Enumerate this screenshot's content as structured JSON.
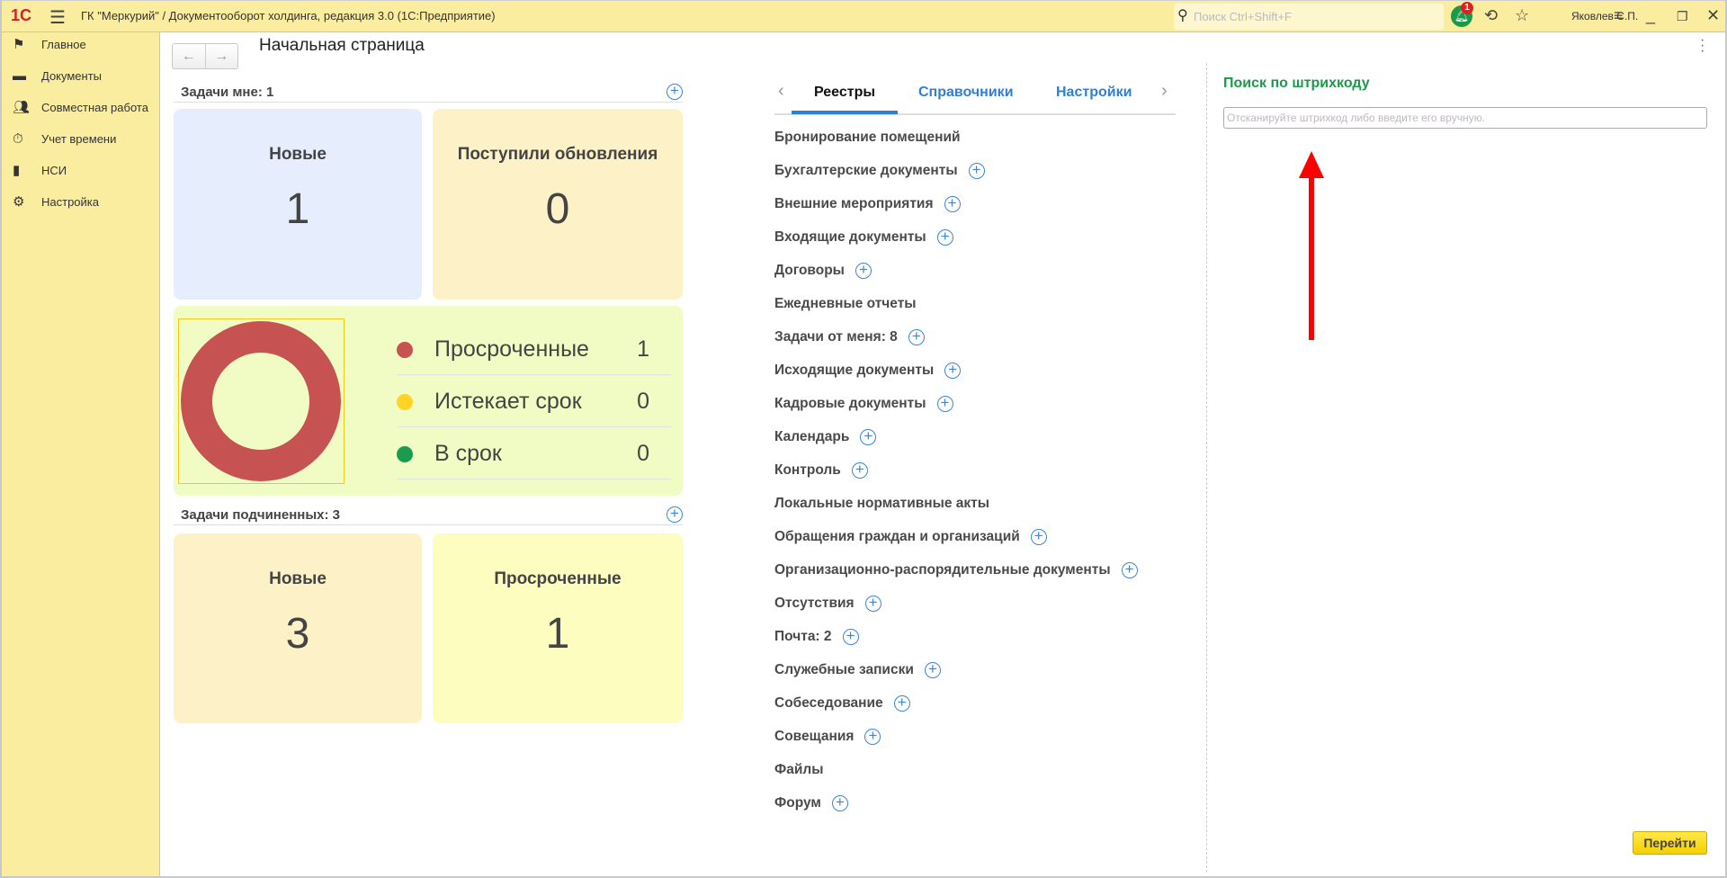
{
  "window": {
    "title": "ГК \"Меркурий\" / Документооборот холдинга, редакция 3.0  (1С:Предприятие)",
    "search_placeholder": "Поиск Ctrl+Shift+F",
    "notifications": "1",
    "user": "Яковлев С.П.",
    "logo": "1С"
  },
  "sidebar": {
    "items": [
      {
        "label": "Главное",
        "icon": "flag-icon"
      },
      {
        "label": "Документы",
        "icon": "folder-icon"
      },
      {
        "label": "Совместная работа",
        "icon": "users-icon"
      },
      {
        "label": "Учет времени",
        "icon": "stopwatch-icon"
      },
      {
        "label": "НСИ",
        "icon": "books-icon"
      },
      {
        "label": "Настройка",
        "icon": "gear-icon"
      }
    ]
  },
  "page": {
    "title": "Начальная страница"
  },
  "my_tasks": {
    "title": "Задачи мне: 1",
    "cards": [
      {
        "label": "Новые",
        "value": "1"
      },
      {
        "label": "Поступили обновления",
        "value": "0"
      }
    ]
  },
  "chart_data": {
    "type": "pie",
    "donut": true,
    "categories": [
      "Просроченные",
      "Истекает срок",
      "В срок"
    ],
    "values": [
      1,
      0,
      0
    ],
    "colors": [
      "#c75252",
      "#ffd426",
      "#1a9b50"
    ]
  },
  "legend": [
    {
      "label": "Просроченные",
      "value": "1"
    },
    {
      "label": "Истекает срок",
      "value": "0"
    },
    {
      "label": "В срок",
      "value": "0"
    }
  ],
  "sub_tasks": {
    "title": "Задачи подчиненных: 3",
    "cards": [
      {
        "label": "Новые",
        "value": "3"
      },
      {
        "label": "Просроченные",
        "value": "1"
      }
    ]
  },
  "tabs": [
    {
      "label": "Реестры",
      "active": true
    },
    {
      "label": "Справочники"
    },
    {
      "label": "Настройки"
    }
  ],
  "registers": [
    {
      "label": "Бронирование помещений",
      "plus": false
    },
    {
      "label": "Бухгалтерские документы",
      "plus": true
    },
    {
      "label": "Внешние мероприятия",
      "plus": true
    },
    {
      "label": "Входящие документы",
      "plus": true
    },
    {
      "label": "Договоры",
      "plus": true
    },
    {
      "label": "Ежедневные отчеты",
      "plus": false
    },
    {
      "label": "Задачи от меня: 8",
      "plus": true
    },
    {
      "label": "Исходящие документы",
      "plus": true
    },
    {
      "label": "Кадровые документы",
      "plus": true
    },
    {
      "label": "Календарь",
      "plus": true
    },
    {
      "label": "Контроль",
      "plus": true
    },
    {
      "label": "Локальные нормативные акты",
      "plus": false
    },
    {
      "label": "Обращения граждан и организаций",
      "plus": true
    },
    {
      "label": "Организационно-распорядительные документы",
      "plus": true
    },
    {
      "label": "Отсутствия",
      "plus": true
    },
    {
      "label": "Почта: 2",
      "plus": true
    },
    {
      "label": "Служебные записки",
      "plus": true
    },
    {
      "label": "Собеседование",
      "plus": true
    },
    {
      "label": "Совещания",
      "plus": true
    },
    {
      "label": "Файлы",
      "plus": false
    },
    {
      "label": "Форум",
      "plus": true
    }
  ],
  "barcode": {
    "title": "Поиск по штрихкоду",
    "placeholder": "Отсканируйте штрихкод либо введите его вручную.",
    "value": "",
    "go_label": "Перейти"
  }
}
